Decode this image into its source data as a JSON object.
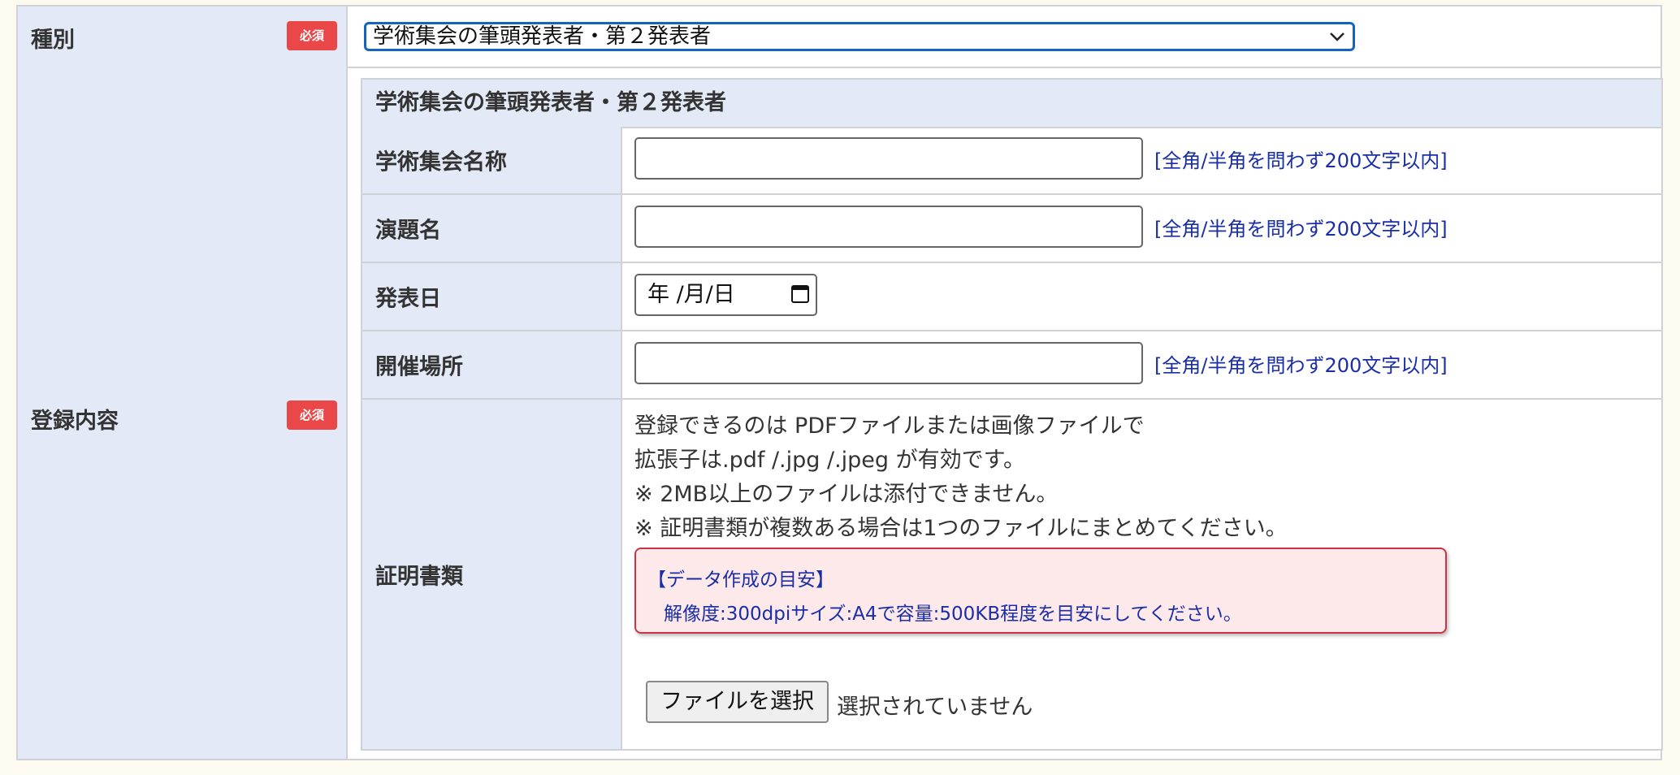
{
  "form": {
    "type_row": {
      "label": "種別",
      "required_badge": "必須",
      "selected_value": "学術集会の筆頭発表者・第２発表者"
    },
    "content_row": {
      "label": "登録内容",
      "required_badge": "必須",
      "section_title": "学術集会の筆頭発表者・第２発表者",
      "fields": {
        "meeting_name": {
          "label": "学術集会名称",
          "value": "",
          "hint": "[全角/半角を問わず200文字以内]"
        },
        "title": {
          "label": "演題名",
          "value": "",
          "hint": "[全角/半角を問わず200文字以内]"
        },
        "date": {
          "label": "発表日",
          "display": "年 /月/日"
        },
        "venue": {
          "label": "開催場所",
          "value": "",
          "hint": "[全角/半角を問わず200文字以内]"
        },
        "certificate": {
          "label": "証明書類",
          "description": [
            "登録できるのは PDFファイルまたは画像ファイルで",
            "拡張子は.pdf /.jpg /.jpeg が有効です。",
            "※ 2MB以上のファイルは添付できません。",
            "※ 証明書類が複数ある場合は1つのファイルにまとめてください。"
          ],
          "notice_title": "【データ作成の目安】",
          "notice_body": "解像度:300dpiサイズ:A4で容量:500KB程度を目安にしてください。",
          "file_button": "ファイルを選択",
          "file_status": "選択されていません"
        }
      }
    }
  },
  "colors": {
    "label_bg": "#e4e9f7",
    "badge_bg": "#ea4848",
    "hint_text": "#1a2ea8",
    "notice_border": "#cc3344",
    "notice_bg": "#fde8ea",
    "select_focus": "#1565c0"
  },
  "icons": {
    "select": "chevron-down-icon",
    "date": "calendar-icon"
  }
}
